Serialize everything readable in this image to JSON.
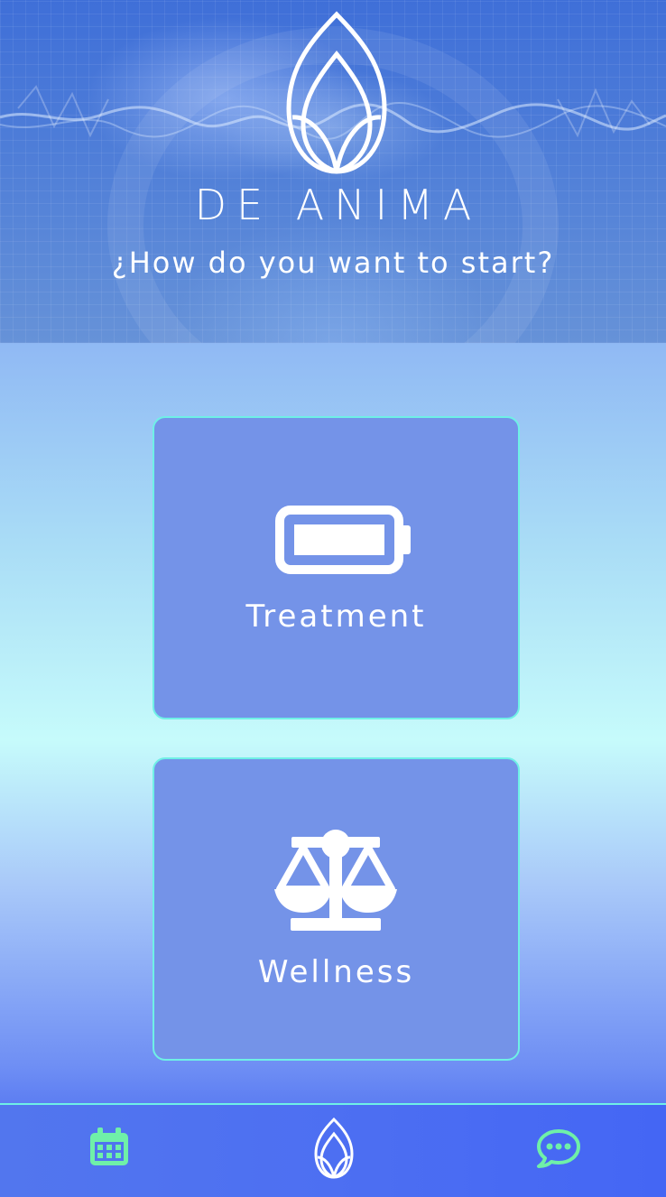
{
  "header": {
    "brand": "DE ANIMA",
    "subtitle": "¿How do you want to start?"
  },
  "options": [
    {
      "label": "Treatment",
      "icon": "battery-icon"
    },
    {
      "label": "Wellness",
      "icon": "balance-scale-icon"
    }
  ],
  "tabbar": {
    "items": [
      {
        "icon": "calendar-icon"
      },
      {
        "icon": "lotus-logo-icon"
      },
      {
        "icon": "chat-bubble-icon"
      }
    ]
  },
  "colors": {
    "accent": "#6ff0e6",
    "card_bg": "#7493e8",
    "hero_bg": "#4f7ed8",
    "tabbar_bg": "#4d6ff2",
    "text": "#ffffff"
  }
}
